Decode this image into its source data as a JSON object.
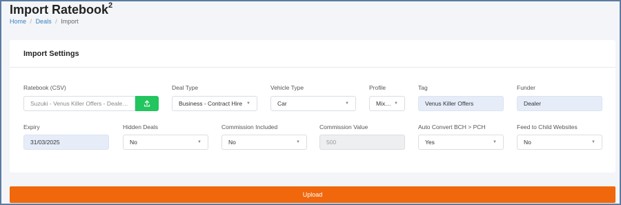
{
  "page": {
    "title": "Import Ratebook",
    "title_sup": "2",
    "breadcrumb": [
      "Home",
      "Deals",
      "Import"
    ],
    "breadcrumb_sep": "/"
  },
  "card": {
    "title": "Import Settings"
  },
  "fields": {
    "ratebook": {
      "label": "Ratebook (CSV)",
      "value": "Suzuki - Venus Killer Offers - Dealer.xlsx"
    },
    "deal_type": {
      "label": "Deal Type",
      "value": "Business - Contract Hire"
    },
    "vehicle_type": {
      "label": "Vehicle Type",
      "value": "Car"
    },
    "profile": {
      "label": "Profile",
      "value": "Mixed"
    },
    "tag": {
      "label": "Tag",
      "value": "Venus Killer Offers"
    },
    "funder": {
      "label": "Funder",
      "value": "Dealer"
    },
    "expiry": {
      "label": "Expiry",
      "value": "31/03/2025"
    },
    "hidden_deals": {
      "label": "Hidden Deals",
      "value": "No"
    },
    "commission_included": {
      "label": "Commission Included",
      "value": "No"
    },
    "commission_value": {
      "label": "Commission Value",
      "value": "500"
    },
    "auto_convert": {
      "label": "Auto Convert BCH > PCH",
      "value": "Yes"
    },
    "feed_child": {
      "label": "Feed to Child Websites",
      "value": "No"
    }
  },
  "upload": {
    "label": "Upload"
  },
  "icons": {
    "upload": "upload-icon",
    "caret": "chevron-down-icon"
  },
  "colors": {
    "accent_orange": "#f0670c",
    "upload_green": "#22c55e",
    "link_blue": "#3b82c4",
    "tint": "#e6edf9"
  }
}
